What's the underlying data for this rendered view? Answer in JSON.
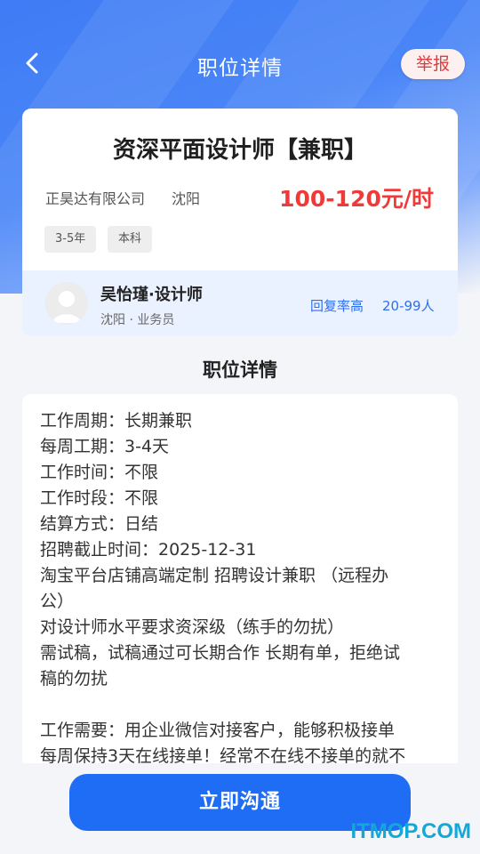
{
  "header": {
    "title": "职位详情",
    "report_label": "举报"
  },
  "job": {
    "title": "资深平面设计师【兼职】",
    "company": "正昊达有限公司",
    "city": "沈阳",
    "salary": "100-120元/时",
    "tags": [
      "3-5年",
      "本科"
    ]
  },
  "recruiter": {
    "name": "吴怡瑾·设计师",
    "sub": "沈阳 · 业务员",
    "reply_label": "回复率高",
    "company_size": "20-99人"
  },
  "section_title": "职位详情",
  "detail_lines": [
    "工作周期：长期兼职",
    "每周工期：3-4天",
    "工作时间：不限",
    "工作时段：不限",
    "结算方式：日结",
    "招聘截止时间：2025-12-31",
    "淘宝平台店铺高端定制 招聘设计兼职 （远程办",
    "公）",
    "对设计师水平要求资深级（练手的勿扰）",
    "需试稿，试稿通过可长期合作 长期有单，拒绝试",
    "稿的勿扰",
    "",
    "工作需要：用企业微信对接客户，能够积极接单",
    "每周保持3天在线接单！经常不在线不接单的就不"
  ],
  "cta_label": "立即沟通",
  "watermark": "ITMOP.COM",
  "colors": {
    "primary": "#1f6df5",
    "salary": "#f03a3a",
    "report": "#e23b3b"
  }
}
